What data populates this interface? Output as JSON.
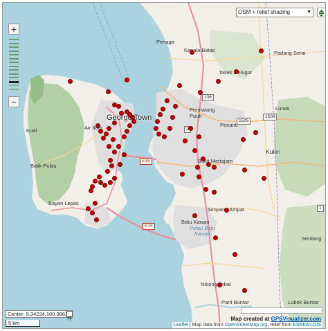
{
  "controls": {
    "zoom_in": "+",
    "zoom_out": "−",
    "zoom_levels": 14,
    "active_zoom_level": 11,
    "layer_select": "OSM + relief shading",
    "center_label": "Center: 5.34224,100.38620",
    "scale_label": "5 km"
  },
  "credits": {
    "created_prefix": "Map created at ",
    "created_link": "GPSVisualizer.com",
    "leaflet": "Leaflet",
    "sep1": " | Map data from ",
    "osm": "OpenStreetMap.org",
    "relief": ", relief from ",
    "esri": "ESRI/ArcGIS"
  },
  "labels": {
    "penaga": "Penaga",
    "kepala_batas": "Kepala Batas",
    "padang_serai": "Padang Serai",
    "tasek_gelugor": "Tasek Gelugor",
    "george_town": "George Town",
    "air_itam": "Air Itam",
    "permatang_pauh": "Permatang\nPauh",
    "penanti": "Penanti",
    "lunas": "Lunas",
    "kulim": "Kulim",
    "kual": "Kual",
    "balik_pulau": "Balik Pulau",
    "bayan_lepas": "Bayan Lepas",
    "bukit_mertajam": "Bukit Mertajam",
    "simpang_ampat": "Simpang Ampat",
    "batu_kawan": "Batu Kawan",
    "pulau_batu_kawan": "Pulau Batu\nKawan",
    "nibong_tebal": "Nibong Tebal",
    "parit_buntar": "Parit Buntar",
    "lubok_buntar": "Lubok Buntar",
    "serdang": "Serdang",
    "road_e36": "E36",
    "road_e28": "E28",
    "road_1505": "1505",
    "road_2": "2",
    "road_136": "136",
    "road_1": "1",
    "road_1508": "1508"
  },
  "markers": {
    "count": 78,
    "color": "#c60000"
  },
  "colors": {
    "sea": "#aad3df",
    "land": "#f2efe9",
    "forest": "#a8c99a",
    "urban": "#e0dfdf",
    "road_major": "#e892a2",
    "marker": "#c60000"
  }
}
